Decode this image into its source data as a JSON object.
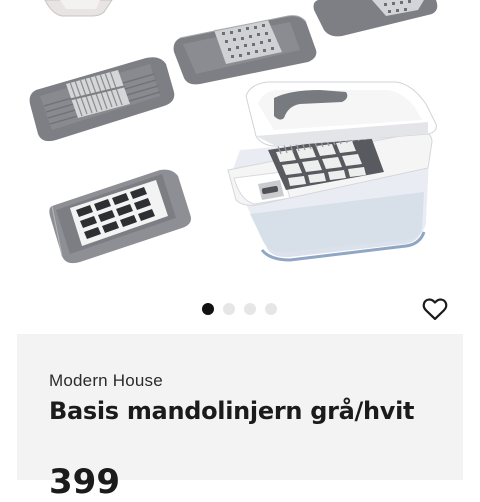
{
  "product": {
    "brand": "Modern House",
    "title": "Basis mandolinjern grå/hvit",
    "price": "399"
  },
  "gallery": {
    "image_count": 4,
    "active_index": 0
  },
  "icons": {
    "favorite": "heart-outline-icon"
  },
  "colors": {
    "active_dot": "#111111",
    "inactive_dot": "#e6e6e6",
    "card_background": "#f3f3f3",
    "blade_gray": "#7d7f84"
  }
}
